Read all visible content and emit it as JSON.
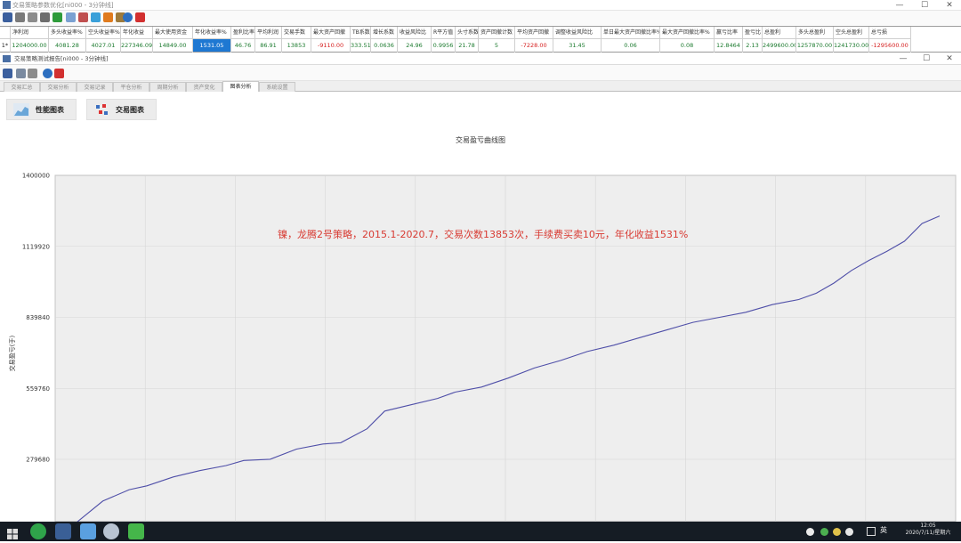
{
  "outer_window": {
    "title": "交易策略参数优化[ni000 - 3分钟线]",
    "minimize": "—",
    "maximize": "☐",
    "close": "✕"
  },
  "stats": {
    "row_num": "1*",
    "headers": [
      "净利润",
      "多头收益率%",
      "空头收益率%",
      "年化收益",
      "最大使用资金",
      "年化收益率%",
      "盈利比率",
      "平均利润",
      "交易手数",
      "最大资产回撤",
      "TB系数",
      "增长系数",
      "收益风险比",
      "R平方值",
      "头寸系数",
      "资产回撤计数",
      "平均资产回撤",
      "调整收益风险比",
      "单日最大资产回撤比率%",
      "最大资产回撤比率%",
      "赢亏比率",
      "盈亏比",
      "总盈利",
      "多头总盈利",
      "空头总盈利",
      "总亏损"
    ],
    "values": [
      "1204000.00",
      "4081.28",
      "4027.01",
      "227346.09",
      "14849.00",
      "1531.05",
      "46.76",
      "86.91",
      "13853",
      "-9110.00",
      "333.51",
      "0.0636",
      "24.96",
      "0.9956",
      "21.78",
      "5",
      "-7228.00",
      "31.45",
      "0.06",
      "0.08",
      "12.8464",
      "2.13",
      "2499600.00",
      "1257870.00",
      "1241730.00",
      "-1295600.00"
    ]
  },
  "inner_window": {
    "title": "交易策略测试报告[ni000 - 3分钟线]",
    "minimize": "—",
    "maximize": "☐",
    "close": "✕"
  },
  "tabs": [
    "交易汇总",
    "交易分析",
    "交易记录",
    "平仓分析",
    "周期分析",
    "资产变化",
    "图表分析",
    "系统设置"
  ],
  "active_tab": "图表分析",
  "chart_buttons": {
    "performance": "性能图表",
    "trade": "交易图表"
  },
  "chart_data": {
    "type": "line",
    "title": "交易盈亏曲线图",
    "ylabel": "交易盈亏(于)",
    "xlabel": "",
    "yticks": [
      279680,
      559760,
      839840,
      1119920,
      1400000
    ],
    "ylim": [
      0,
      1400000
    ],
    "grid": true,
    "series": [
      {
        "color": "#4f4fa8",
        "x": [
          0,
          0.02,
          0.05,
          0.08,
          0.1,
          0.13,
          0.16,
          0.19,
          0.21,
          0.24,
          0.27,
          0.3,
          0.32,
          0.35,
          0.37,
          0.4,
          0.43,
          0.45,
          0.48,
          0.51,
          0.54,
          0.57,
          0.6,
          0.63,
          0.66,
          0.69,
          0.72,
          0.75,
          0.78,
          0.81,
          0.84,
          0.86,
          0.88,
          0.9,
          0.92,
          0.94,
          0.96,
          0.98,
          1.0
        ],
        "values": [
          0,
          30000,
          115000,
          160000,
          175000,
          210000,
          235000,
          255000,
          275000,
          280000,
          320000,
          340000,
          345000,
          400000,
          470000,
          495000,
          520000,
          545000,
          565000,
          600000,
          640000,
          670000,
          705000,
          730000,
          760000,
          790000,
          820000,
          840000,
          860000,
          890000,
          910000,
          935000,
          975000,
          1025000,
          1065000,
          1100000,
          1140000,
          1210000,
          1240000
        ]
      }
    ]
  },
  "annotation": "镍，龙腾2号策略，2015.1-2020.7，交易次数13853次，手续费买卖10元，年化收益1531%",
  "taskbar": {
    "tray_text": "英",
    "clock_time": "12:05",
    "clock_date": "2020/7/11/星期六"
  }
}
